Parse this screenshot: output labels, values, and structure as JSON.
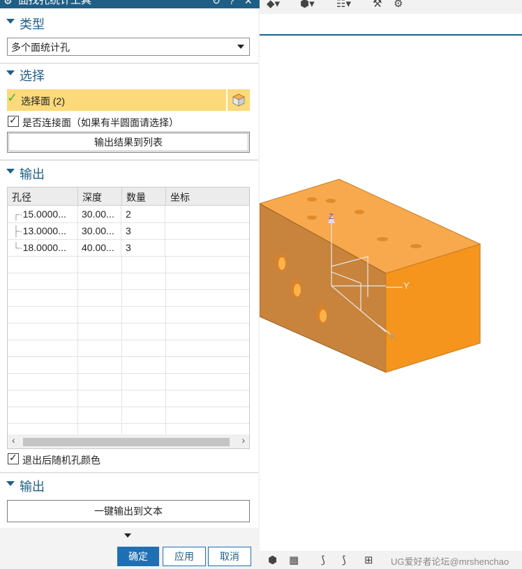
{
  "dialog": {
    "title": "面找孔统计工具"
  },
  "type_section": {
    "header": "类型",
    "dropdown_value": "多个面统计孔"
  },
  "select_section": {
    "header": "选择",
    "select_face_label": "选择面 (2)",
    "connected_checkbox_label": "是否连接面（如果有半圆面请选择）",
    "connected_checked": true,
    "output_list_button": "输出结果到列表"
  },
  "output_section": {
    "header": "输出",
    "columns": [
      "孔径",
      "深度",
      "数量",
      "坐标"
    ],
    "rows": [
      {
        "diameter": "15.0000...",
        "depth": "30.00...",
        "count": "2",
        "coord": ""
      },
      {
        "diameter": "13.0000...",
        "depth": "30.00...",
        "count": "3",
        "coord": ""
      },
      {
        "diameter": "18.0000...",
        "depth": "40.00...",
        "count": "3",
        "coord": ""
      }
    ],
    "random_color_label": "退出后随机孔颜色",
    "random_color_checked": true
  },
  "output_section_2": {
    "header": "输出",
    "export_text_button": "一键输出到文本"
  },
  "footer": {
    "ok": "确定",
    "apply": "应用",
    "cancel": "取消"
  },
  "viewport": {
    "axis_labels": {
      "z": "Z",
      "y": "Y",
      "x": "X"
    },
    "watermark": "UG爱好者论坛@mrshenchao"
  },
  "colors": {
    "accent": "#1f5f86",
    "selection_highlight": "#fcd97a",
    "block_orange": "#f5951e",
    "ok_button": "#1f6fb5"
  }
}
